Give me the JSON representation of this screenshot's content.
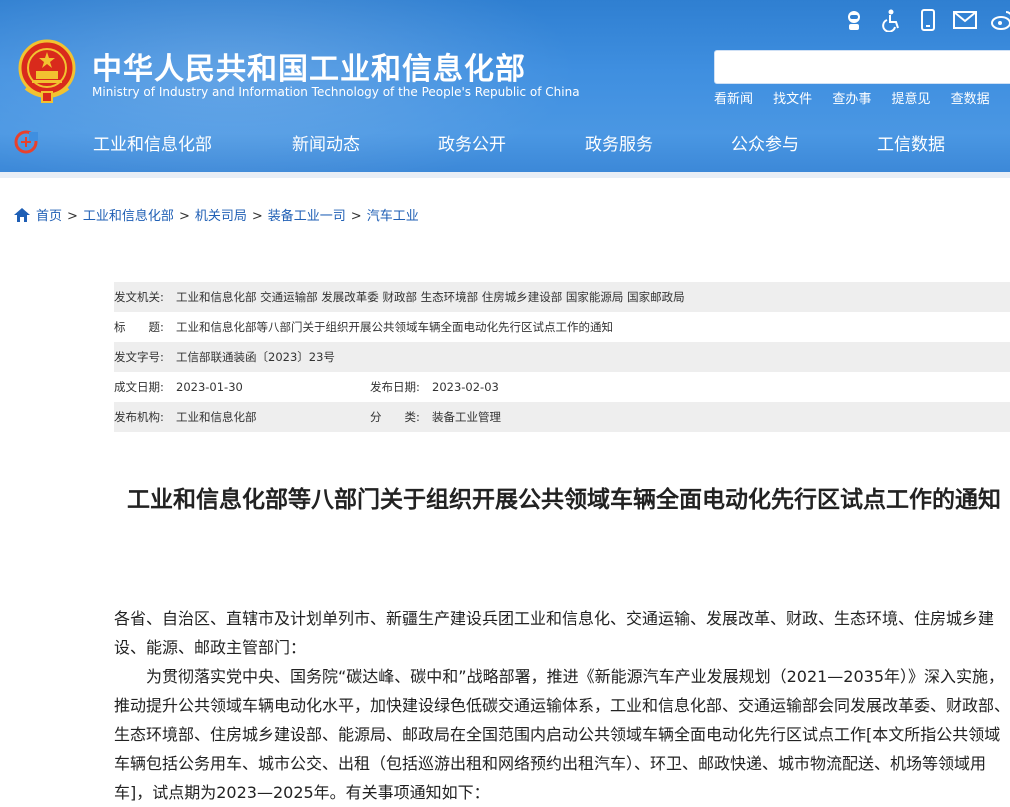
{
  "header": {
    "site_title": "中华人民共和国工业和信息化部",
    "site_subtitle": "Ministry of Industry and Information Technology of the People's Republic of China",
    "search_placeholder": "",
    "quick_links": [
      "看新闻",
      "找文件",
      "查办事",
      "提意见",
      "查数据"
    ],
    "top_icons": [
      "robot-assistant-icon",
      "accessibility-icon",
      "mobile-icon",
      "mail-icon",
      "weibo-icon"
    ],
    "accent_color": "#3f8fe0"
  },
  "nav": {
    "items": [
      "工业和信息化部",
      "新闻动态",
      "政务公开",
      "政务服务",
      "公众参与",
      "工信数据"
    ]
  },
  "breadcrumb": {
    "items": [
      "首页",
      "工业和信息化部",
      "机关司局",
      "装备工业一司",
      "汽车工业"
    ]
  },
  "meta": {
    "issuer_label": "发文机关:",
    "issuer_value": "工业和信息化部 交通运输部 发展改革委 财政部 生态环境部 住房城乡建设部 国家能源局 国家邮政局",
    "title_label": "标　　题:",
    "title_value": "工业和信息化部等八部门关于组织开展公共领域车辆全面电动化先行区试点工作的通知",
    "doc_no_label": "发文字号:",
    "doc_no_value": "工信部联通装函〔2023〕23号",
    "created_label": "成文日期:",
    "created_value": "2023-01-30",
    "published_label": "发布日期:",
    "published_value": "2023-02-03",
    "agency_label": "发布机构:",
    "agency_value": "工业和信息化部",
    "category_label": "分　　类:",
    "category_value": "装备工业管理"
  },
  "article": {
    "title": "工业和信息化部等八部门关于组织开展公共领域车辆全面电动化先行区试点工作的通知",
    "salutation": "各省、自治区、直辖市及计划单列市、新疆生产建设兵团工业和信息化、交通运输、发展改革、财政、生态环境、住房城乡建设、能源、邮政主管部门：",
    "paragraph1": "为贯彻落实党中央、国务院“碳达峰、碳中和”战略部署，推进《新能源汽车产业发展规划（2021—2035年）》深入实施，推动提升公共领域车辆电动化水平，加快建设绿色低碳交通运输体系，工业和信息化部、交通运输部会同发展改革委、财政部、生态环境部、住房城乡建设部、能源局、邮政局在全国范围内启动公共领域车辆全面电动化先行区试点工作[本文所指公共领域车辆包括公务用车、城市公交、出租（包括巡游出租和网络预约出租汽车）、环卫、邮政快递、城市物流配送、机场等领域用车]，试点期为2023—2025年。有关事项通知如下："
  }
}
